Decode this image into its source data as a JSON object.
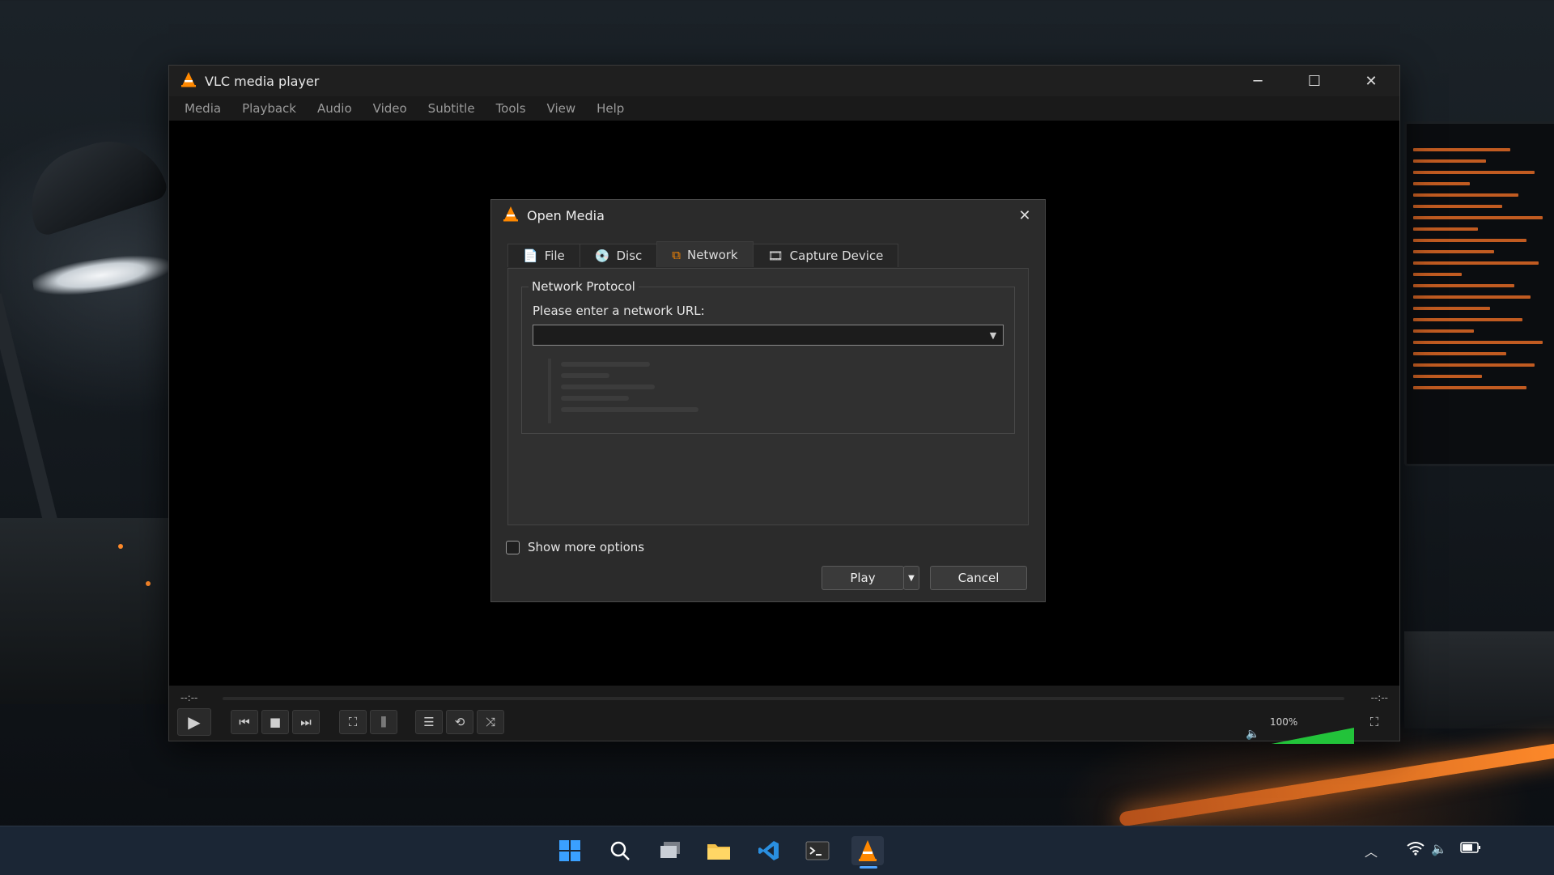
{
  "window": {
    "title": "VLC media player",
    "controls": {
      "minimize": "─",
      "maximize": "☐",
      "close": "✕"
    }
  },
  "menubar": {
    "items": [
      "Media",
      "Playback",
      "Audio",
      "Video",
      "Subtitle",
      "Tools",
      "View",
      "Help"
    ]
  },
  "player": {
    "elapsed": "--:--",
    "remaining": "--:--",
    "volume": "100%",
    "volume_level": 1.0
  },
  "dialog": {
    "title": "Open Media",
    "tabs": [
      {
        "label": "File",
        "icon": "file-icon"
      },
      {
        "label": "Disc",
        "icon": "disc-icon"
      },
      {
        "label": "Network",
        "icon": "network-icon",
        "active": true
      },
      {
        "label": "Capture Device",
        "icon": "capture-device-icon"
      }
    ],
    "group_title": "Network Protocol",
    "url_label": "Please enter a network URL:",
    "url_value": "",
    "show_more_options": "Show more options",
    "play_button": "Play",
    "cancel_button": "Cancel"
  },
  "colors": {
    "accent_orange": "#ff8800",
    "volume_green": "#22c33a",
    "taskbar_bg": "#1b2635"
  },
  "taskbar": {
    "icons": [
      "windows-start-icon",
      "search-icon",
      "task-view-icon",
      "file-explorer-icon",
      "vscode-icon",
      "terminal-icon",
      "vlc-icon"
    ],
    "tray": [
      "chevron-up-icon",
      "wifi-icon",
      "speaker-icon",
      "battery-icon"
    ]
  }
}
